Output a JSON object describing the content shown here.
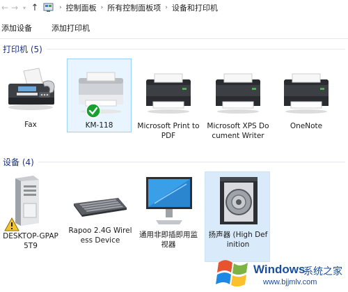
{
  "breadcrumb": {
    "items": [
      "控制面板",
      "所有控制面板项",
      "设备和打印机"
    ]
  },
  "commandbar": {
    "add_device": "添加设备",
    "add_printer": "添加打印机"
  },
  "printers": {
    "header": "打印机 (5)",
    "items": [
      {
        "label": "Fax",
        "icon": "fax-machine-icon"
      },
      {
        "label": "KM-118",
        "icon": "printer-icon",
        "badge": "default-printer-check-icon",
        "selected": true
      },
      {
        "label": "Microsoft Print to PDF",
        "icon": "printer-icon"
      },
      {
        "label": "Microsoft XPS Document Writer",
        "icon": "printer-icon"
      },
      {
        "label": "OneNote",
        "icon": "printer-icon"
      }
    ]
  },
  "devices": {
    "header": "设备 (4)",
    "items": [
      {
        "label": "DESKTOP-GPAP5T9",
        "icon": "computer-tower-icon",
        "badge": "warning-icon"
      },
      {
        "label": "Rapoo 2.4G Wireless Device",
        "icon": "keyboard-icon"
      },
      {
        "label": "通用非即插即用监视器",
        "icon": "monitor-icon"
      },
      {
        "label": "扬声器 (High Definition",
        "icon": "speaker-icon"
      }
    ]
  },
  "watermark": {
    "brand": "Windows",
    "cn": "系统之家",
    "url": "www.bjjmlv.com"
  },
  "colors": {
    "group_header": "#1e3287",
    "selection_border": "#99d1ff",
    "selection_fill": "#e8f4ff",
    "hover_fill": "#d9ebfa",
    "check_green": "#16a02d",
    "warning_yellow": "#f4c430"
  }
}
